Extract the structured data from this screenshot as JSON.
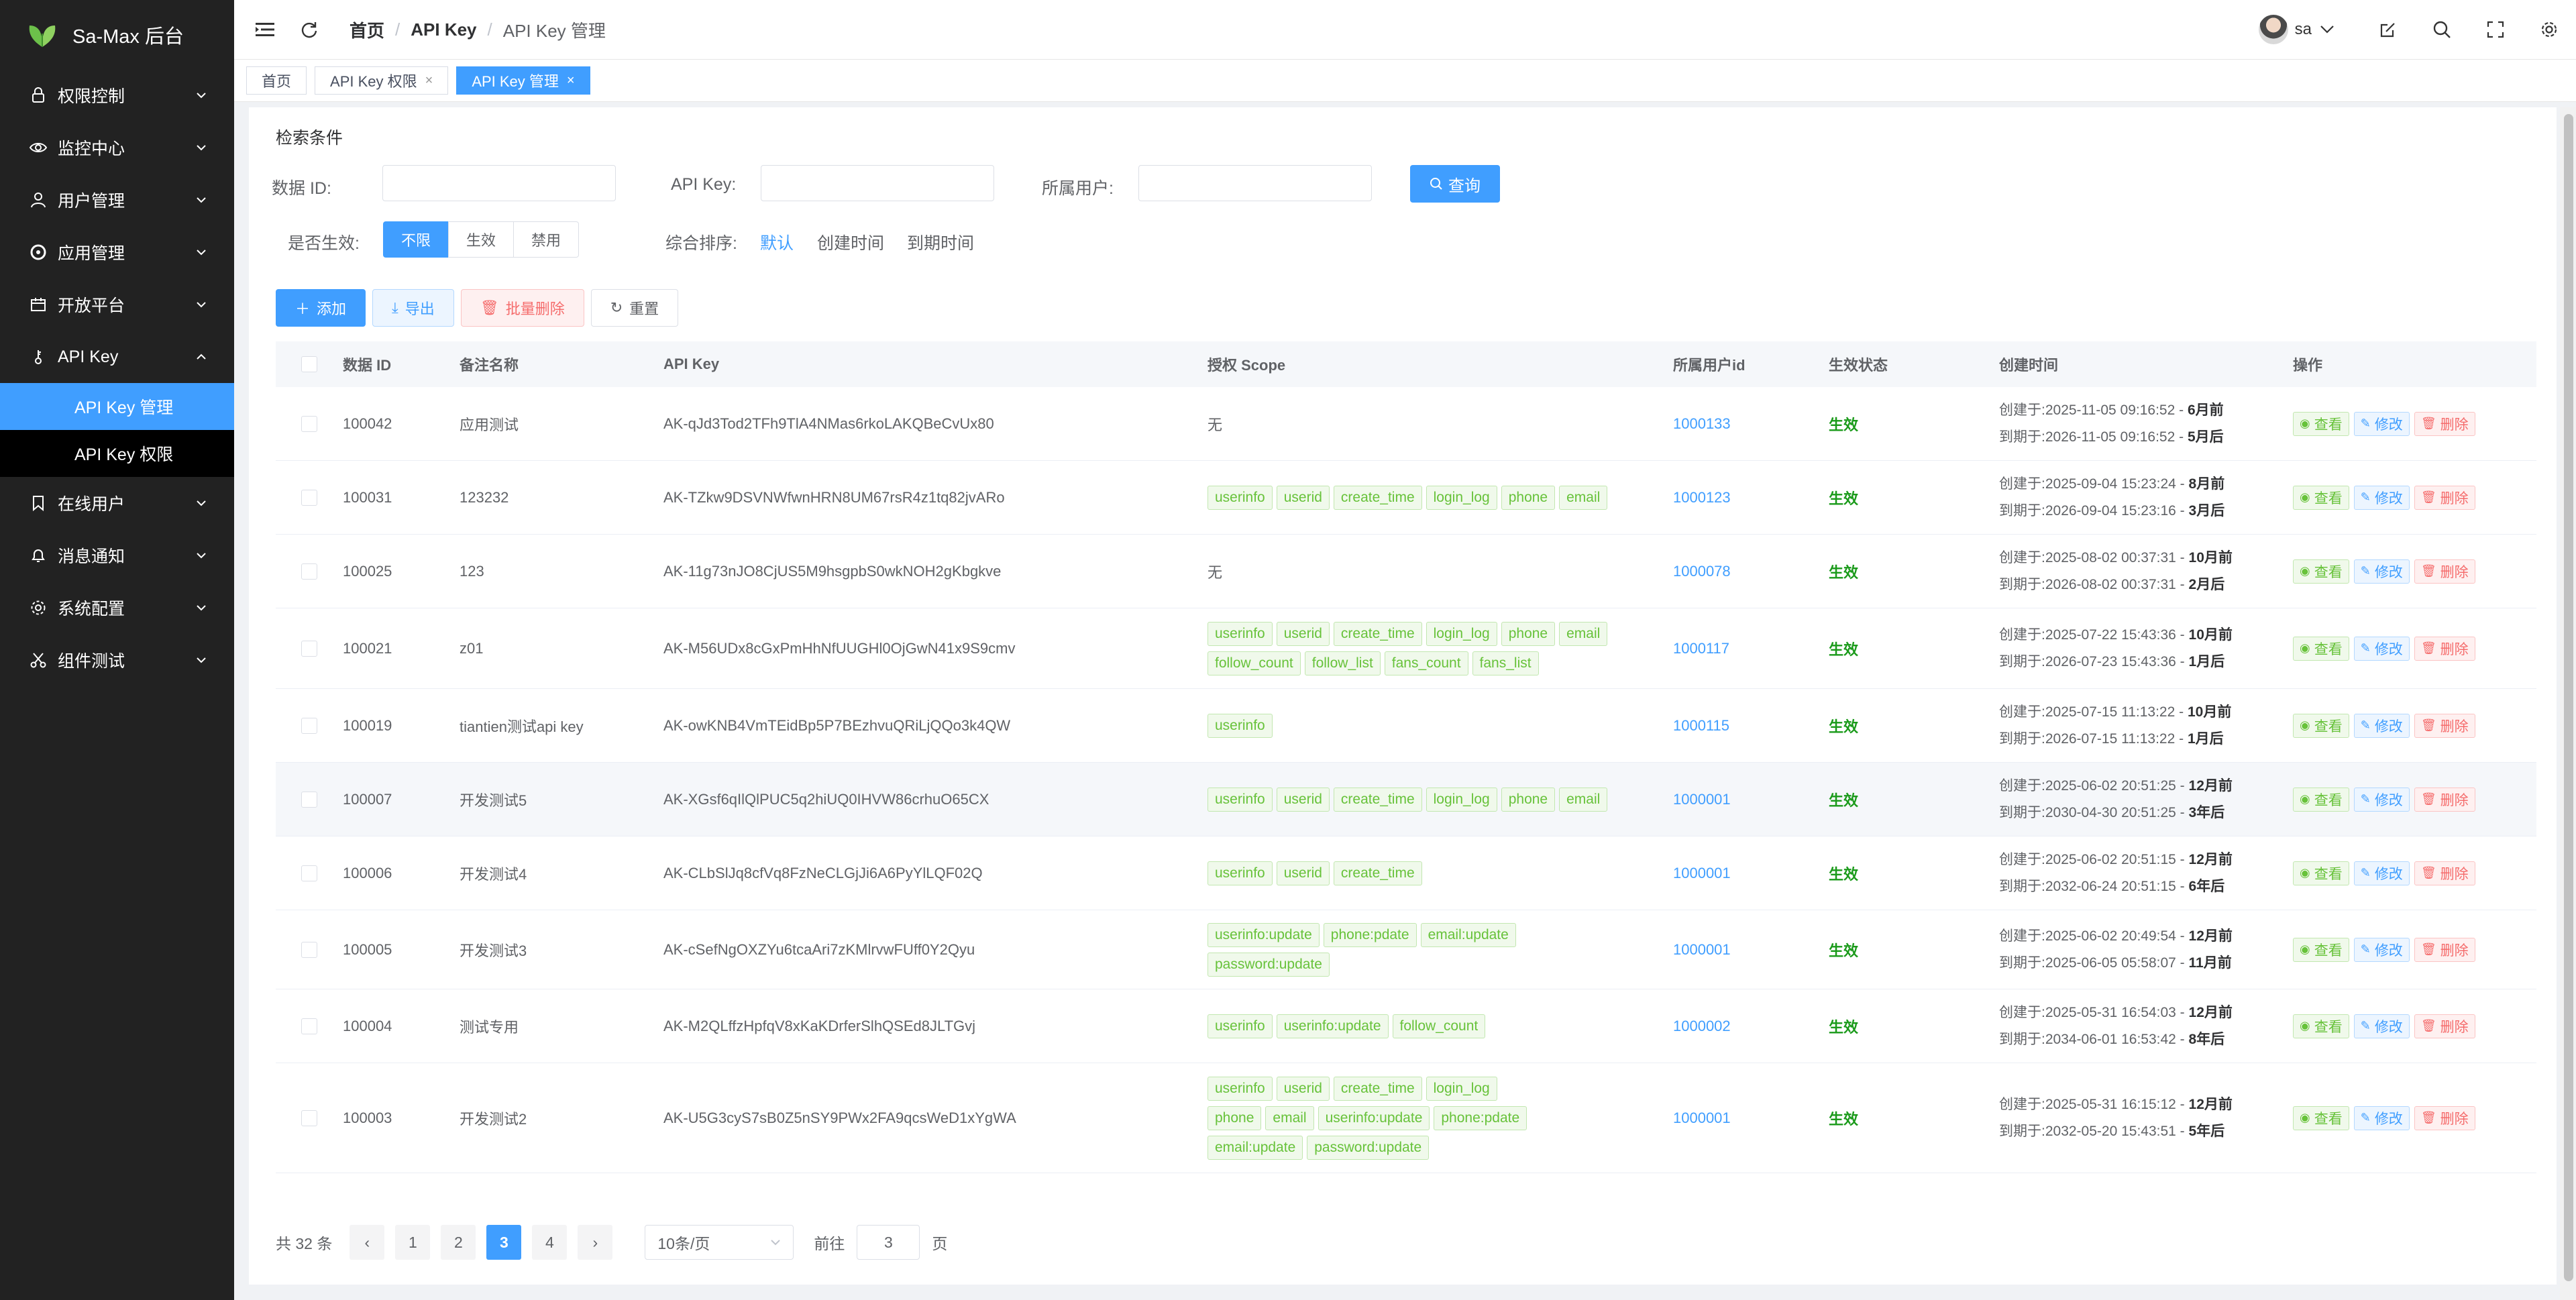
{
  "app": {
    "title": "Sa-Max 后台"
  },
  "colors": {
    "sidebar_bg": "#222222",
    "accent": "#409eff",
    "success": "#67c23a",
    "danger": "#f56c6c",
    "status_on": "#1a9a1a"
  },
  "sidebar": {
    "items": [
      {
        "label": "权限控制",
        "icon": "lock-icon"
      },
      {
        "label": "监控中心",
        "icon": "eye-icon"
      },
      {
        "label": "用户管理",
        "icon": "user-icon"
      },
      {
        "label": "应用管理",
        "icon": "app-icon"
      },
      {
        "label": "开放平台",
        "icon": "platform-icon"
      },
      {
        "label": "API Key",
        "icon": "key-icon",
        "expanded": true,
        "children": [
          {
            "label": "API Key 管理",
            "active": true
          },
          {
            "label": "API Key 权限"
          }
        ]
      },
      {
        "label": "在线用户",
        "icon": "bookmark-icon"
      },
      {
        "label": "消息通知",
        "icon": "bell-icon"
      },
      {
        "label": "系统配置",
        "icon": "gear-icon"
      },
      {
        "label": "组件测试",
        "icon": "scissors-icon"
      }
    ]
  },
  "header": {
    "breadcrumb": [
      "首页",
      "API Key",
      "API Key 管理"
    ],
    "user": "sa"
  },
  "tabs": [
    {
      "label": "首页",
      "closable": false
    },
    {
      "label": "API Key 权限",
      "closable": true
    },
    {
      "label": "API Key 管理",
      "closable": true,
      "active": true
    }
  ],
  "filters": {
    "title": "检索条件",
    "data_id_label": "数据 ID:",
    "data_id_value": "",
    "api_key_label": "API Key:",
    "api_key_value": "",
    "user_label": "所属用户:",
    "user_value": "",
    "query_button": "查询",
    "enabled_label": "是否生效:",
    "enabled_options": [
      "不限",
      "生效",
      "禁用"
    ],
    "enabled_selected": "不限",
    "sort_label": "综合排序:",
    "sort_options": [
      "默认",
      "创建时间",
      "到期时间"
    ],
    "sort_selected": "默认"
  },
  "toolbar": {
    "add": "添加",
    "export": "导出",
    "batch_delete": "批量删除",
    "reset": "重置"
  },
  "table": {
    "columns": [
      "数据 ID",
      "备注名称",
      "API Key",
      "授权 Scope",
      "所属用户id",
      "生效状态",
      "创建时间",
      "操作"
    ],
    "created_prefix": "创建于:",
    "expires_prefix": "到期于:",
    "actions": {
      "view": "查看",
      "edit": "修改",
      "delete": "删除"
    },
    "rows": [
      {
        "id": "100042",
        "name": "应用测试",
        "key": "AK-qJd3Tod2TFh9TlA4NMas6rkoLAKQBeCvUx80",
        "scopes": [],
        "scope_text": "无",
        "uid": "1000133",
        "status": "生效",
        "created": "2025-11-05 09:16:52",
        "created_ago": "6月前",
        "expires": "2026-11-05 09:16:52",
        "expires_in": "5月后"
      },
      {
        "id": "100031",
        "name": "123232",
        "key": "AK-TZkw9DSVNWfwnHRN8UM67rsR4z1tq82jvARo",
        "scopes": [
          "userinfo",
          "userid",
          "create_time",
          "login_log",
          "phone",
          "email"
        ],
        "uid": "1000123",
        "status": "生效",
        "created": "2025-09-04 15:23:24",
        "created_ago": "8月前",
        "expires": "2026-09-04 15:23:16",
        "expires_in": "3月后"
      },
      {
        "id": "100025",
        "name": "123",
        "key": "AK-11g73nJO8CjUS5M9hsgpbS0wkNOH2gKbgkve",
        "scopes": [],
        "scope_text": "无",
        "uid": "1000078",
        "status": "生效",
        "created": "2025-08-02 00:37:31",
        "created_ago": "10月前",
        "expires": "2026-08-02 00:37:31",
        "expires_in": "2月后"
      },
      {
        "id": "100021",
        "name": "z01",
        "key": "AK-M56UDx8cGxPmHhNfUUGHl0OjGwN41x9S9cmv",
        "scopes": [
          "userinfo",
          "userid",
          "create_time",
          "login_log",
          "phone",
          "email",
          "follow_count",
          "follow_list",
          "fans_count",
          "fans_list"
        ],
        "uid": "1000117",
        "status": "生效",
        "created": "2025-07-22 15:43:36",
        "created_ago": "10月前",
        "expires": "2026-07-23 15:43:36",
        "expires_in": "1月后"
      },
      {
        "id": "100019",
        "name": "tiantien测试api key",
        "key": "AK-owKNB4VmTEidBp5P7BEzhvuQRiLjQQo3k4QW",
        "scopes": [
          "userinfo"
        ],
        "uid": "1000115",
        "status": "生效",
        "created": "2025-07-15 11:13:22",
        "created_ago": "10月前",
        "expires": "2026-07-15 11:13:22",
        "expires_in": "1月后"
      },
      {
        "id": "100007",
        "name": "开发测试5",
        "key": "AK-XGsf6qIlQlPUC5q2hiUQ0IHVW86crhuO65CX",
        "scopes": [
          "userinfo",
          "userid",
          "create_time",
          "login_log",
          "phone",
          "email"
        ],
        "uid": "1000001",
        "status": "生效",
        "created": "2025-06-02 20:51:25",
        "created_ago": "12月前",
        "expires": "2030-04-30 20:51:25",
        "expires_in": "3年后",
        "highlight": true
      },
      {
        "id": "100006",
        "name": "开发测试4",
        "key": "AK-CLbSlJq8cfVq8FzNeCLGjJi6A6PyYlLQF02Q",
        "scopes": [
          "userinfo",
          "userid",
          "create_time"
        ],
        "uid": "1000001",
        "status": "生效",
        "created": "2025-06-02 20:51:15",
        "created_ago": "12月前",
        "expires": "2032-06-24 20:51:15",
        "expires_in": "6年后"
      },
      {
        "id": "100005",
        "name": "开发测试3",
        "key": "AK-cSefNgOXZYu6tcaAri7zKMlrvwFUff0Y2Qyu",
        "scopes": [
          "userinfo:update",
          "phone:pdate",
          "email:update",
          "password:update"
        ],
        "uid": "1000001",
        "status": "生效",
        "created": "2025-06-02 20:49:54",
        "created_ago": "12月前",
        "expires": "2025-06-05 05:58:07",
        "expires_in": "11月前"
      },
      {
        "id": "100004",
        "name": "测试专用",
        "key": "AK-M2QLffzHpfqV8xKaKDrferSlhQSEd8JLTGvj",
        "scopes": [
          "userinfo",
          "userinfo:update",
          "follow_count"
        ],
        "uid": "1000002",
        "status": "生效",
        "created": "2025-05-31 16:54:03",
        "created_ago": "12月前",
        "expires": "2034-06-01 16:53:42",
        "expires_in": "8年后"
      },
      {
        "id": "100003",
        "name": "开发测试2",
        "key": "AK-U5G3cyS7sB0Z5nSY9PWx2FA9qcsWeD1xYgWA",
        "scopes": [
          "userinfo",
          "userid",
          "create_time",
          "login_log",
          "phone",
          "email",
          "userinfo:update",
          "phone:pdate",
          "email:update",
          "password:update"
        ],
        "uid": "1000001",
        "status": "生效",
        "created": "2025-05-31 16:15:12",
        "created_ago": "12月前",
        "expires": "2032-05-20 15:43:51",
        "expires_in": "5年后"
      }
    ]
  },
  "pagination": {
    "total_text": "共 32 条",
    "pages": [
      "1",
      "2",
      "3",
      "4"
    ],
    "current": "3",
    "page_size": "10条/页",
    "goto_label": "前往",
    "goto_value": "3",
    "page_suffix": "页"
  }
}
